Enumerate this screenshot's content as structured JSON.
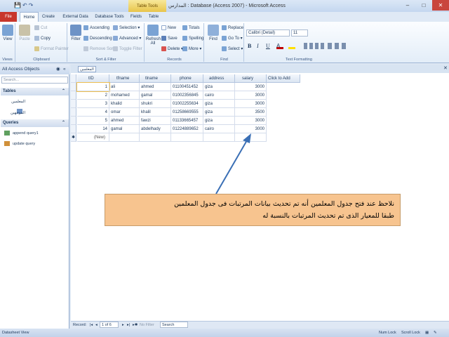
{
  "window": {
    "title": "المدارس : Database (Access 2007) - Microsoft Access",
    "table_tools": "Table Tools",
    "qat_icons": [
      "save-icon",
      "undo-icon",
      "redo-icon"
    ],
    "min": "–",
    "max": "□",
    "close": "✕"
  },
  "tabs": [
    "File",
    "Home",
    "Create",
    "External Data",
    "Database Tools",
    "Fields",
    "Table"
  ],
  "ribbon": {
    "views": {
      "view": "View",
      "group": "Views"
    },
    "clipboard": {
      "paste": "Paste",
      "cut": "Cut",
      "copy": "Copy",
      "format_painter": "Format Painter",
      "group": "Clipboard"
    },
    "sort_filter": {
      "filter": "Filter",
      "ascending": "Ascending",
      "descending": "Descending",
      "remove_sort": "Remove Sort",
      "selection": "Selection",
      "advanced": "Advanced",
      "toggle_filter": "Toggle Filter",
      "group": "Sort & Filter"
    },
    "records": {
      "refresh": "Refresh All",
      "new": "New",
      "save": "Save",
      "delete": "Delete",
      "totals": "Totals",
      "spelling": "Spelling",
      "more": "More",
      "group": "Records"
    },
    "find": {
      "find": "Find",
      "replace": "Replace",
      "goto": "Go To",
      "select": "Select",
      "group": "Find"
    },
    "text_formatting": {
      "font": "Calibri (Detail)",
      "size": "11",
      "bold": "B",
      "italic": "I",
      "underline": "U",
      "group": "Text Formatting"
    }
  },
  "nav": {
    "header": "All Access Objects",
    "search_placeholder": "Search...",
    "sections": [
      {
        "label": "Tables",
        "items": [
          "المعلمين",
          "الموجهين"
        ]
      },
      {
        "label": "Queries",
        "items": [
          "append query1",
          "update query"
        ]
      }
    ]
  },
  "document": {
    "tab": "المعلمين",
    "columns": [
      "tID",
      "tfname",
      "tlname",
      "phone",
      "address",
      "salary",
      "Click to Add"
    ],
    "rows": [
      [
        "1",
        "ali",
        "ahmed",
        "01100451452",
        "giza",
        "3000"
      ],
      [
        "2",
        "mohamed",
        "gamal",
        "01002356845",
        "cairo",
        "3000"
      ],
      [
        "3",
        "khalid",
        "shukri",
        "01002255634",
        "giza",
        "3000"
      ],
      [
        "4",
        "omar",
        "khalil",
        "01258669555",
        "giza",
        "3500"
      ],
      [
        "5",
        "ahmed",
        "fawzi",
        "01133665457",
        "giza",
        "3000"
      ],
      [
        "14",
        "gamal",
        "abdelhady",
        "01224889652",
        "cairo",
        "3000"
      ]
    ],
    "new_row": "(New)"
  },
  "record_nav": {
    "label": "Record:",
    "position": "1 of 6",
    "filter": "No Filter",
    "search": "Search"
  },
  "status": {
    "left": "Datasheet View",
    "num_lock": "Num Lock",
    "scroll_lock": "Scroll Lock"
  },
  "callout": {
    "line1": "نلاحظ عند فتح جدول المعلمين أنه تم تحديث بيانات المرتبات فى جدول المعلمين",
    "line2": "طبقا للمعيار الذى تم تحديث المرتبات بالنسبة له"
  },
  "colors": {
    "file_tab": "#c8362b",
    "callout": "#f7c48f",
    "arrow": "#3a6fb5",
    "table_tools": "#e8c44a"
  }
}
